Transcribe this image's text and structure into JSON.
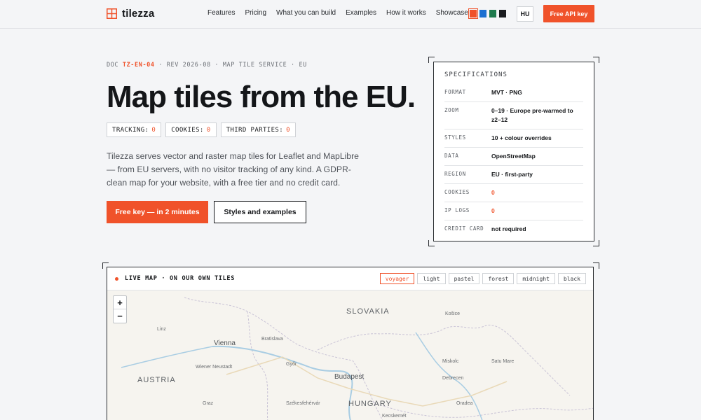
{
  "brand": {
    "name": "tilezza"
  },
  "nav": [
    "Features",
    "Pricing",
    "What you can build",
    "Examples",
    "How it works",
    "Showcase"
  ],
  "swatches": [
    "#f0522a",
    "#1b6fd1",
    "#1e7a4d",
    "#1a1c1f"
  ],
  "language": "HU",
  "header_cta": "Free API key",
  "doc": {
    "prefix": "DOC",
    "code": "TZ-EN-04",
    "rest": "· REV 2026-08 · MAP TILE SERVICE · EU"
  },
  "hero": {
    "title": "Map tiles from the EU.",
    "badges": [
      {
        "label": "TRACKING:",
        "value": "0"
      },
      {
        "label": "COOKIES:",
        "value": "0"
      },
      {
        "label": "THIRD PARTIES:",
        "value": "0"
      }
    ],
    "lead": "Tilezza serves vector and raster map tiles for Leaflet and MapLibre — from EU servers, with no visitor tracking of any kind. A GDPR-clean map for your website, with a free tier and no credit card.",
    "primary_cta": "Free key — in 2 minutes",
    "secondary_cta": "Styles and examples"
  },
  "specs": {
    "title": "SPECIFICATIONS",
    "rows": [
      {
        "key": "FORMAT",
        "value": "MVT · PNG"
      },
      {
        "key": "ZOOM",
        "value": "0–19 · Europe pre-warmed to z2–12"
      },
      {
        "key": "STYLES",
        "value": "10 + colour overrides"
      },
      {
        "key": "DATA",
        "value": "OpenStreetMap"
      },
      {
        "key": "REGION",
        "value": "EU · first-party"
      },
      {
        "key": "COOKIES",
        "value": "0"
      },
      {
        "key": "IP LOGS",
        "value": "0"
      },
      {
        "key": "CREDIT CARD",
        "value": "not required"
      }
    ]
  },
  "map": {
    "label": "LIVE MAP · ON OUR OWN TILES",
    "styles": [
      "voyager",
      "light",
      "pastel",
      "forest",
      "midnight",
      "black"
    ],
    "active_style": "voyager",
    "zoom_in": "+",
    "zoom_out": "−",
    "places": [
      {
        "name": "SLOVAKIA",
        "kind": "country"
      },
      {
        "name": "AUSTRIA",
        "kind": "country"
      },
      {
        "name": "HUNGARY",
        "kind": "country"
      },
      {
        "name": "Vienna",
        "kind": "big"
      },
      {
        "name": "Budapest",
        "kind": "big"
      },
      {
        "name": "Bratislava",
        "kind": "small"
      },
      {
        "name": "Linz",
        "kind": "small"
      },
      {
        "name": "Wiener Neustadt",
        "kind": "small"
      },
      {
        "name": "Graz",
        "kind": "small"
      },
      {
        "name": "Győr",
        "kind": "small"
      },
      {
        "name": "Székesfehérvár",
        "kind": "small"
      },
      {
        "name": "Košice",
        "kind": "small"
      },
      {
        "name": "Miskolc",
        "kind": "small"
      },
      {
        "name": "Debrecen",
        "kind": "small"
      },
      {
        "name": "Satu Mare",
        "kind": "small"
      },
      {
        "name": "Oradea",
        "kind": "small"
      },
      {
        "name": "Kecskemét",
        "kind": "small"
      }
    ]
  }
}
